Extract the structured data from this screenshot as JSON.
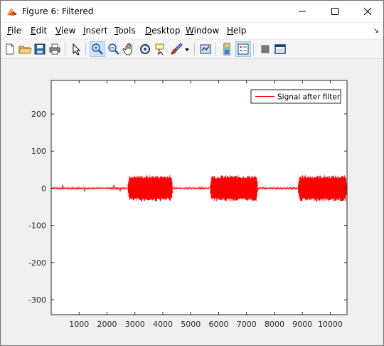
{
  "window": {
    "title": "Figure 6: Filtered",
    "minimize_label": "—",
    "maximize_label": "☐",
    "close_label": "✕"
  },
  "menu": {
    "items": [
      {
        "label": "File",
        "accel": "F"
      },
      {
        "label": "Edit",
        "accel": "E"
      },
      {
        "label": "View",
        "accel": "V"
      },
      {
        "label": "Insert",
        "accel": "I"
      },
      {
        "label": "Tools",
        "accel": "T"
      },
      {
        "label": "Desktop",
        "accel": "D"
      },
      {
        "label": "Window",
        "accel": "W"
      },
      {
        "label": "Help",
        "accel": "H"
      }
    ],
    "overflow_arrow": "↘"
  },
  "toolbar": {
    "buttons": [
      "new-figure-icon",
      "open-file-icon",
      "save-icon",
      "print-icon",
      "edit-plot-arrow-icon",
      "zoom-in-icon",
      "zoom-out-icon",
      "pan-hand-icon",
      "rotate-3d-icon",
      "data-cursor-icon",
      "brush-icon",
      "brush-dropdown-icon",
      "link-plot-icon",
      "insert-colorbar-icon",
      "insert-legend-icon",
      "hide-plot-tools-icon",
      "show-plot-tools-icon"
    ],
    "active": [
      "zoom-in-icon",
      "insert-legend-icon"
    ]
  },
  "chart_data": {
    "type": "line",
    "title": "",
    "xlabel": "",
    "ylabel": "",
    "xlim": [
      0,
      10600
    ],
    "ylim": [
      -340,
      290
    ],
    "xticks": [
      1000,
      2000,
      3000,
      4000,
      5000,
      6000,
      7000,
      8000,
      9000,
      10000
    ],
    "yticks": [
      200,
      100,
      0,
      -100,
      -200,
      -300
    ],
    "grid": false,
    "legend_position": "top-right",
    "series": [
      {
        "name": "Signal after filter",
        "color": "#ff0000",
        "segments": [
          {
            "x_start": 0,
            "x_end": 2750,
            "amplitude": 3
          },
          {
            "x_start": 2750,
            "x_end": 4350,
            "amplitude": 35
          },
          {
            "x_start": 4350,
            "x_end": 5700,
            "amplitude": 3
          },
          {
            "x_start": 5700,
            "x_end": 7400,
            "amplitude": 35
          },
          {
            "x_start": 7400,
            "x_end": 8850,
            "amplitude": 3
          },
          {
            "x_start": 8850,
            "x_end": 10600,
            "amplitude": 35
          }
        ]
      }
    ]
  }
}
